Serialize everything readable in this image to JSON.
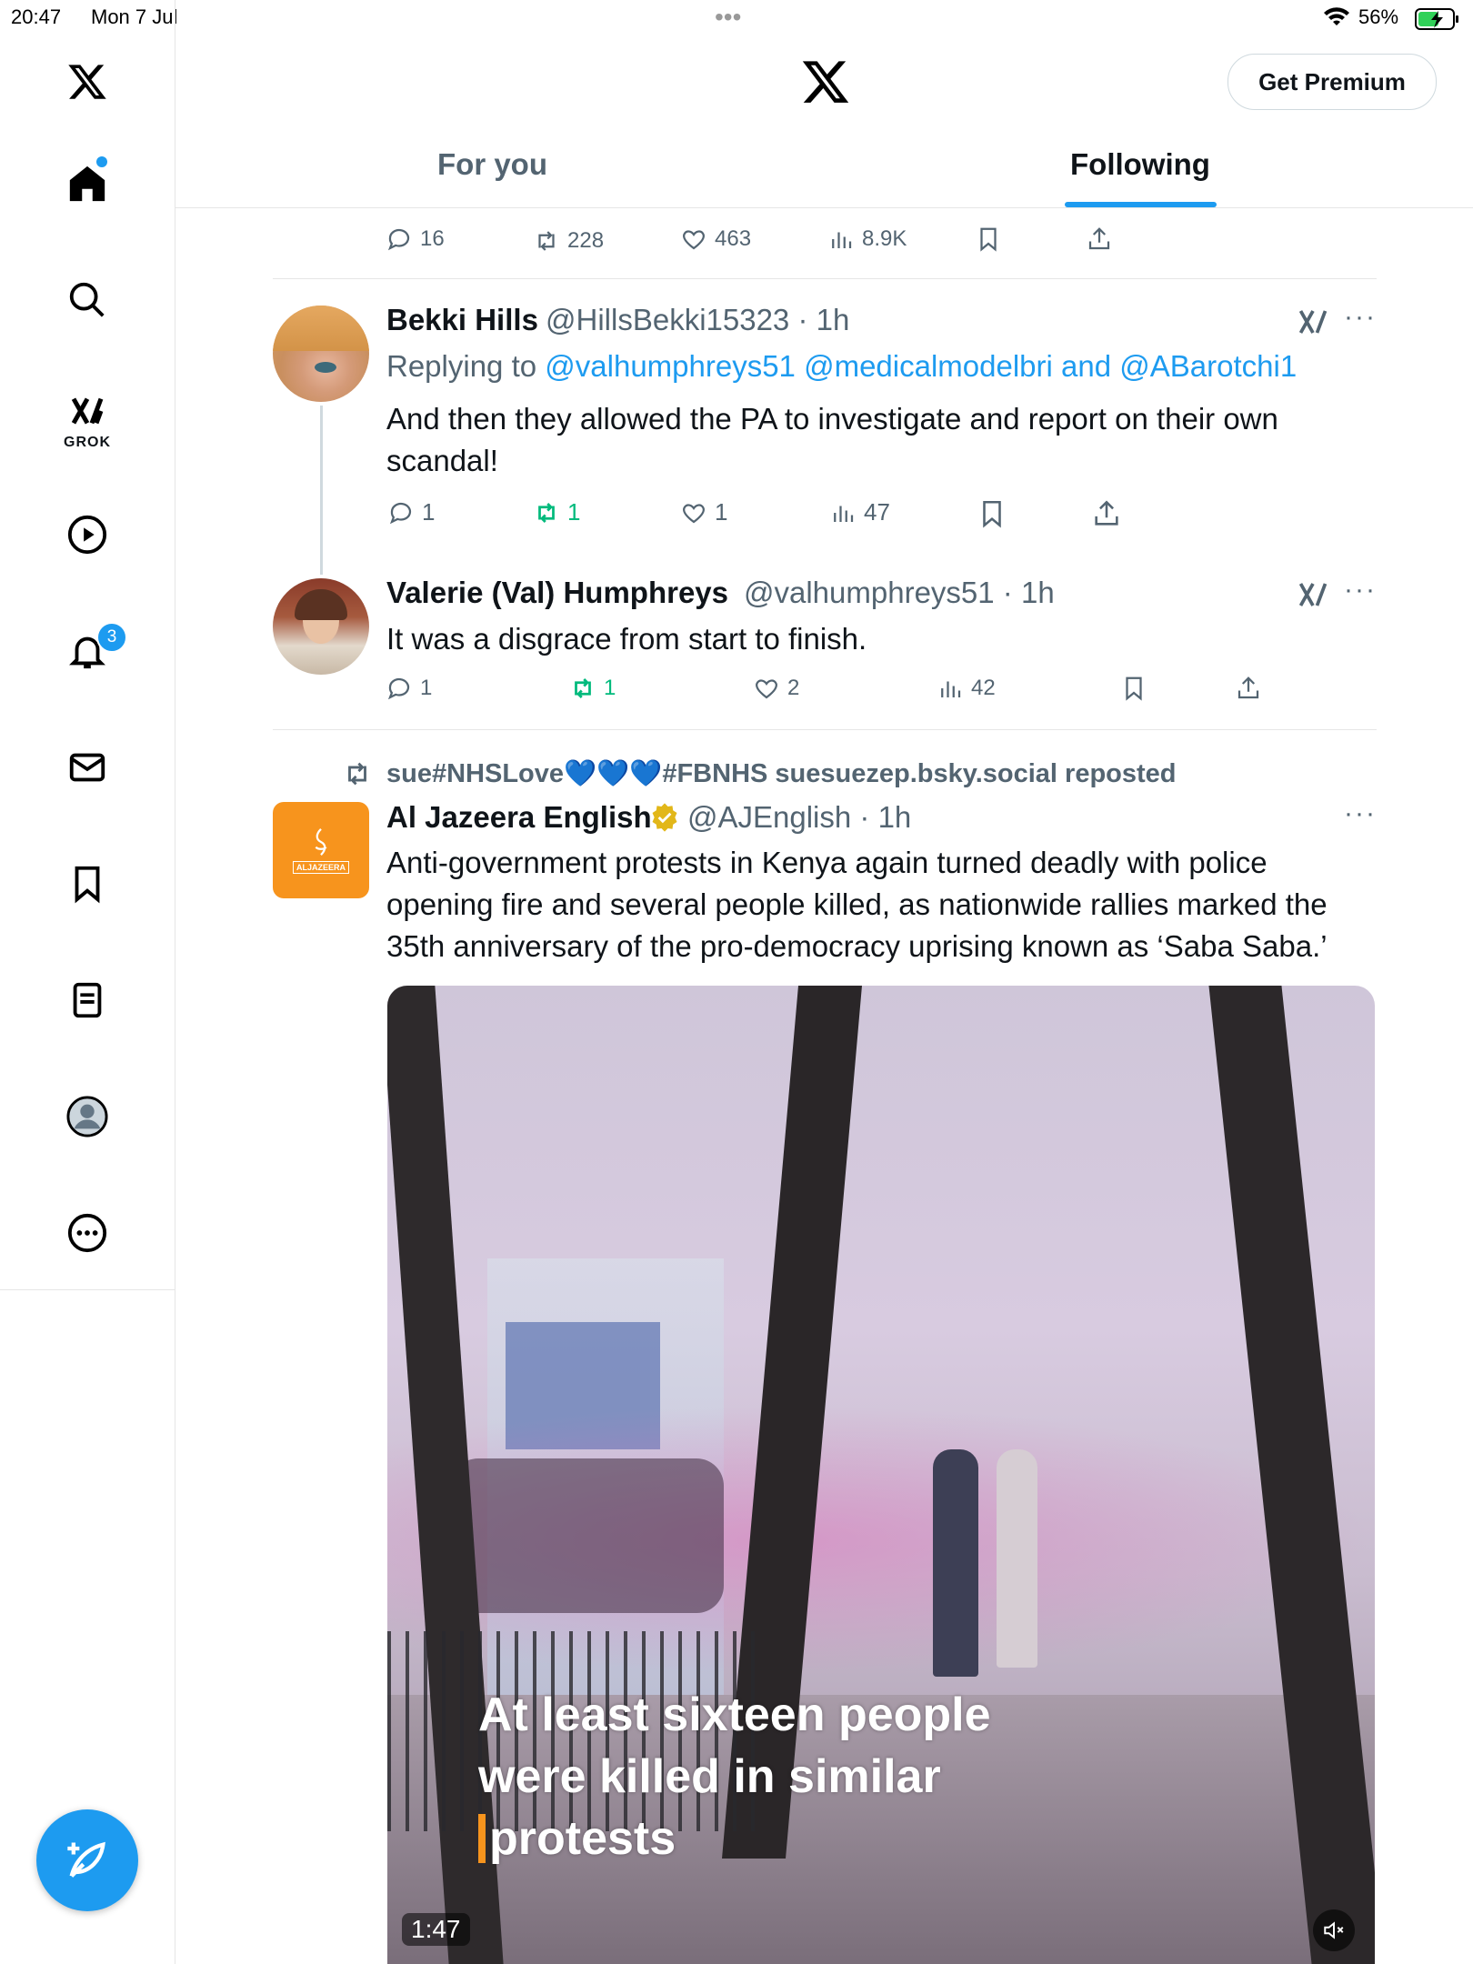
{
  "status_bar": {
    "time": "20:47",
    "date": "Mon 7 Jul",
    "battery": "56%"
  },
  "header": {
    "premium_label": "Get Premium",
    "tabs": [
      {
        "label": "For you"
      },
      {
        "label": "Following"
      }
    ],
    "active_tab": "Following"
  },
  "sidebar": {
    "grok_label": "GROK",
    "notification_count": "3"
  },
  "top_actions": {
    "replies": "16",
    "reposts": "228",
    "likes": "463",
    "views": "8.9K"
  },
  "tweets": [
    {
      "name": "Bekki Hills",
      "handle": "@HillsBekki15323 · 1h",
      "replying_prefix": "Replying to",
      "replying_to": "@valhumphreys51 @medicalmodelbri and @ABarotchi1",
      "text_line1": "And then they allowed the PA to investigate and report on their own",
      "text_line2": "scandal!",
      "replies": "1",
      "reposts": "1",
      "likes": "1",
      "views": "47"
    },
    {
      "name": "Valerie (Val) Humphreys",
      "handle": "@valhumphreys51 · 1h",
      "text_line1": "It was a disgrace from start to finish.",
      "replies": "1",
      "reposts": "1",
      "likes": "2",
      "views": "42"
    },
    {
      "repost_label": "sue#NHSLove💙💙💙#FBNHS suesuezep.bsky.social reposted",
      "name": "Al Jazeera English",
      "handle": "@AJEnglish · 1h",
      "avatar_label": "ALJAZEERA",
      "text_line1": "Anti-government protests in Kenya again turned deadly with police",
      "text_line2": "opening fire and several people killed, as nationwide rallies marked the",
      "text_line3": "35th anniversary of the pro-democracy uprising known as ‘Saba Saba.’",
      "video_caption_line1": "At least sixteen people",
      "video_caption_line2": "were killed in similar",
      "video_caption_line3": "protests",
      "video_duration": "1:47"
    }
  ],
  "colors": {
    "accent": "#1d9bf0",
    "repost_green": "#00ba7c",
    "secondary_text": "#536471",
    "aljazeera_orange": "#f7941d"
  }
}
